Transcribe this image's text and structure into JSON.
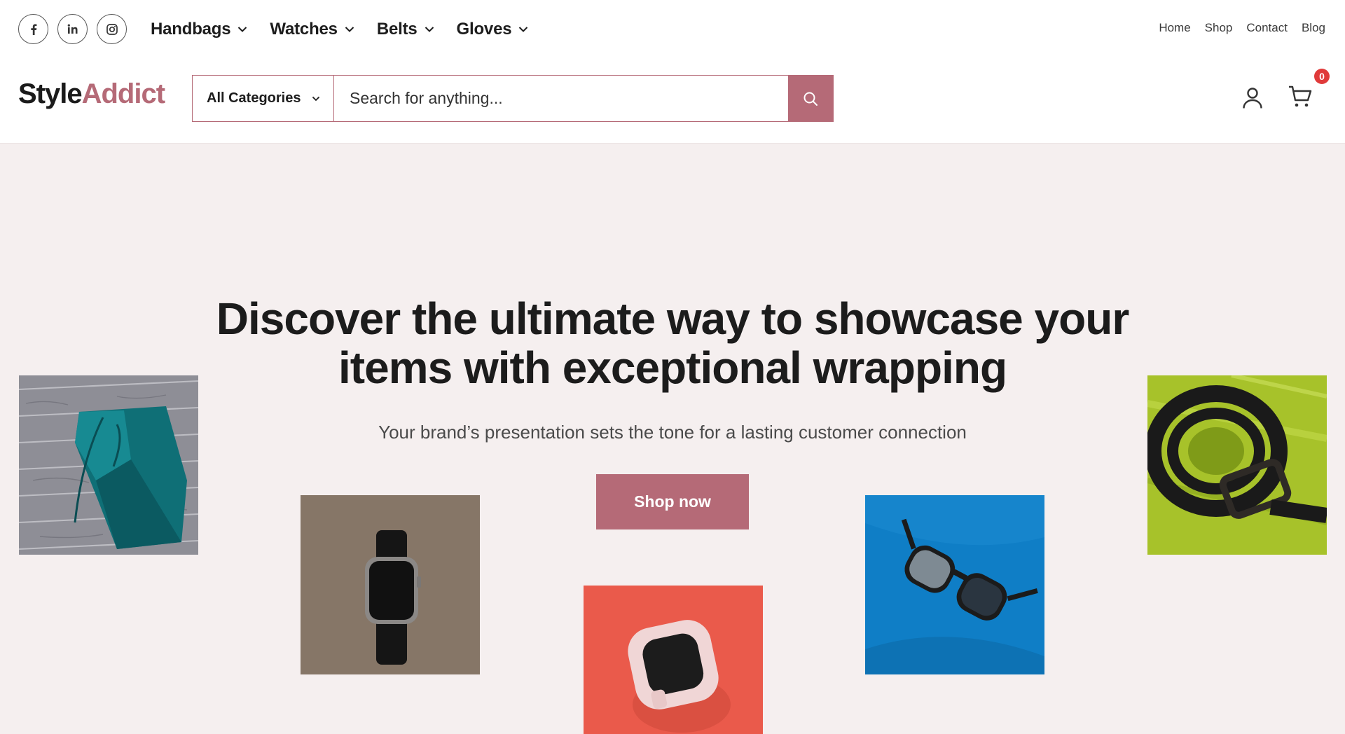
{
  "social": [
    {
      "name": "facebook-icon",
      "glyph": "f"
    },
    {
      "name": "linkedin-icon",
      "glyph": "in"
    },
    {
      "name": "instagram-icon",
      "glyph": "ig"
    }
  ],
  "categories_nav": [
    {
      "label": "Handbags"
    },
    {
      "label": "Watches"
    },
    {
      "label": "Belts"
    },
    {
      "label": "Gloves"
    }
  ],
  "top_links": [
    "Home",
    "Shop",
    "Contact",
    "Blog"
  ],
  "logo": {
    "part1": "Style",
    "part2": "Addict"
  },
  "search": {
    "category_label": "All Categories",
    "placeholder": "Search for anything..."
  },
  "cart": {
    "count": "0"
  },
  "hero": {
    "title": "Discover the ultimate way to showcase your items with exceptional wrapping",
    "subtitle": "Your brand’s presentation sets the tone for a lasting customer connection",
    "cta_label": "Shop now"
  },
  "colors": {
    "accent": "#b56a77",
    "background": "#f5efef",
    "badge": "#e03a3a"
  },
  "products": [
    {
      "name": "teal-handbag-photo"
    },
    {
      "name": "smartwatch-photo"
    },
    {
      "name": "watch-case-photo"
    },
    {
      "name": "sunglasses-photo"
    },
    {
      "name": "leather-belt-photo"
    }
  ]
}
